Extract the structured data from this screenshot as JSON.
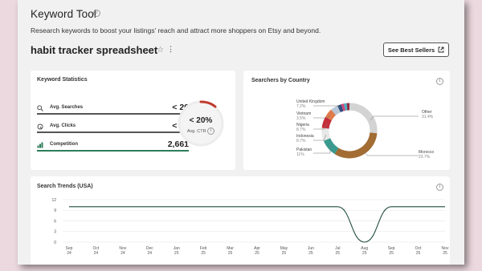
{
  "header": {
    "title": "Keyword Tool",
    "info_icon": "info-icon",
    "subtitle": "Research keywords to boost your listings' reach and attract more shoppers on Etsy and beyond."
  },
  "keyword": {
    "title": "habit tracker spreadsheet",
    "favorite_icon": "star-icon",
    "more_icon": "more-icon",
    "best_sellers_label": "See Best Sellers"
  },
  "keyword_statistics": {
    "title": "Keyword Statistics",
    "rows": [
      {
        "label": "Avg. Searches",
        "value": "< 20",
        "icon": "search-icon"
      },
      {
        "label": "Avg. Clicks",
        "value": "< 20",
        "icon": "click-icon"
      },
      {
        "label": "Competition",
        "value": "2,661",
        "icon": "competition-icon"
      }
    ],
    "ctr": {
      "value": "< 20%",
      "label": "Avg. CTR"
    }
  },
  "searchers_by_country": {
    "title": "Searchers by Country",
    "countries": [
      {
        "name": "United Kingdom",
        "pct": "7.2%",
        "color": "#b9c7d9"
      },
      {
        "name": "Vietnam",
        "pct": "3.5%",
        "color": "#e07b4c"
      },
      {
        "name": "Nigeria",
        "pct": "8.7%",
        "color": "#c62d3a"
      },
      {
        "name": "Indonesia",
        "pct": "8.7%",
        "color": "#d7d7d7"
      },
      {
        "name": "Pakistan",
        "pct": "11%",
        "color": "#3a9a8f"
      },
      {
        "name": "Other",
        "pct": "31.4%",
        "color": "#d3d3d3"
      },
      {
        "name": "Morocco",
        "pct": "23.7%",
        "color": "#a26c33"
      }
    ]
  },
  "search_trends": {
    "title": "Search Trends (USA)"
  },
  "chart_data": {
    "type": "line",
    "title": "Search Trends (USA)",
    "categories": [
      "Sep 24",
      "Oct 24",
      "Nov 24",
      "Dec 24",
      "Jan 25",
      "Feb 25",
      "Mar 25",
      "Apr 25",
      "May 25",
      "Jun 25",
      "Jul 25",
      "Aug 25",
      "Sep 25",
      "Oct 25",
      "Nov 25"
    ],
    "series": [
      {
        "values": [
          10,
          10,
          10,
          10,
          10,
          10,
          10,
          10,
          10,
          10,
          10,
          0,
          10,
          10,
          10
        ]
      }
    ],
    "ylim": [
      0,
      12
    ],
    "yticks": [
      0,
      3,
      6,
      9,
      12
    ],
    "color": "#1f4d3a",
    "grid": true
  }
}
